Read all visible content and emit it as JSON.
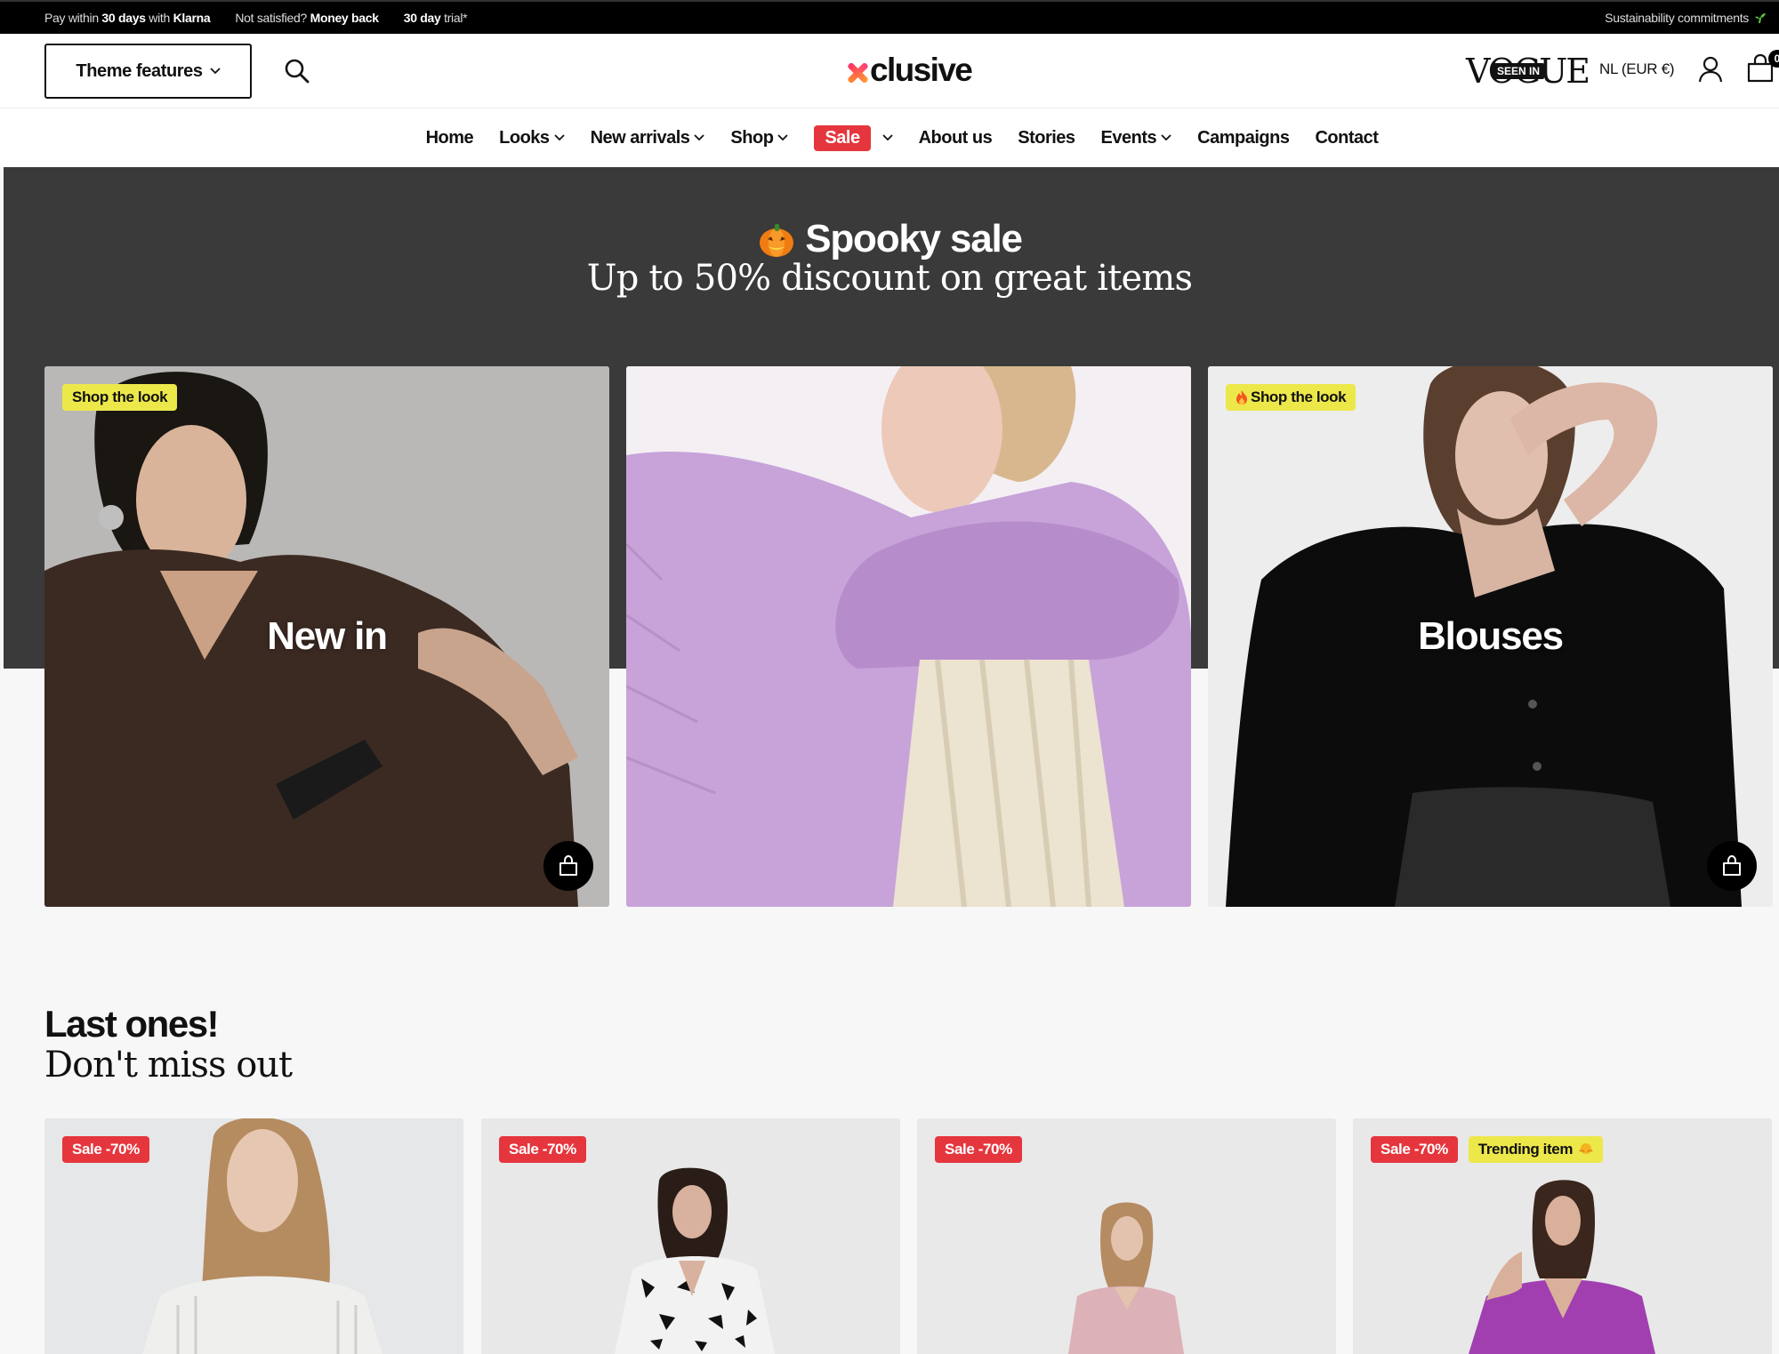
{
  "topbar": {
    "items": [
      {
        "prefix": "Pay within ",
        "bold": "30 days",
        "middle": " with ",
        "bold2": "Klarna"
      },
      {
        "prefix": "Not satisfied? ",
        "bold": "Money back",
        "middle": "",
        "bold2": ""
      },
      {
        "prefix": "",
        "bold": "30 day",
        "middle": " trial*",
        "bold2": ""
      }
    ],
    "right_label": "Sustainability commitments",
    "right_icon": "sprout-icon"
  },
  "header": {
    "theme_button_label": "Theme features",
    "search_icon": "search-icon",
    "logo_text": "clusive",
    "logo_mark": "x",
    "press_logo_word": "VOGUE",
    "press_badge": "SEEN IN",
    "locale": "NL (EUR €)",
    "account_icon": "user-icon",
    "cart_icon": "shopping-bag-icon",
    "cart_count": "0"
  },
  "nav": {
    "items": [
      {
        "label": "Home",
        "has_dropdown": false,
        "highlight": false
      },
      {
        "label": "Looks",
        "has_dropdown": true,
        "highlight": false
      },
      {
        "label": "New arrivals",
        "has_dropdown": true,
        "highlight": false
      },
      {
        "label": "Shop",
        "has_dropdown": true,
        "highlight": false
      },
      {
        "label": "Sale",
        "has_dropdown": true,
        "highlight": true
      },
      {
        "label": "About us",
        "has_dropdown": false,
        "highlight": false
      },
      {
        "label": "Stories",
        "has_dropdown": false,
        "highlight": false
      },
      {
        "label": "Events",
        "has_dropdown": true,
        "highlight": false
      },
      {
        "label": "Campaigns",
        "has_dropdown": false,
        "highlight": false
      },
      {
        "label": "Contact",
        "has_dropdown": false,
        "highlight": false
      }
    ]
  },
  "banner": {
    "emoji_icon": "pumpkin-icon",
    "title": "Spooky sale",
    "subtitle": "Up to 50% discount on great items"
  },
  "feature_cards": [
    {
      "label": "New in",
      "tag": "Shop the look",
      "tag_icon": "",
      "has_bag_button": true
    },
    {
      "label": "",
      "tag": "",
      "tag_icon": "",
      "has_bag_button": false
    },
    {
      "label": "Blouses",
      "tag": "Shop the look",
      "tag_icon": "fire-icon",
      "has_bag_button": true
    }
  ],
  "section": {
    "title": "Last ones!",
    "subtitle": "Don't miss out"
  },
  "products": [
    {
      "badges": [
        "Sale -70%"
      ],
      "trending": ""
    },
    {
      "badges": [
        "Sale -70%"
      ],
      "trending": ""
    },
    {
      "badges": [
        "Sale -70%"
      ],
      "trending": ""
    },
    {
      "badges": [
        "Sale -70%"
      ],
      "trending": "Trending item"
    }
  ],
  "colors": {
    "sale_red": "#e5363d",
    "tag_yellow": "#ede84a",
    "banner_dark": "#3a3a3a",
    "topbar_black": "#000000"
  }
}
